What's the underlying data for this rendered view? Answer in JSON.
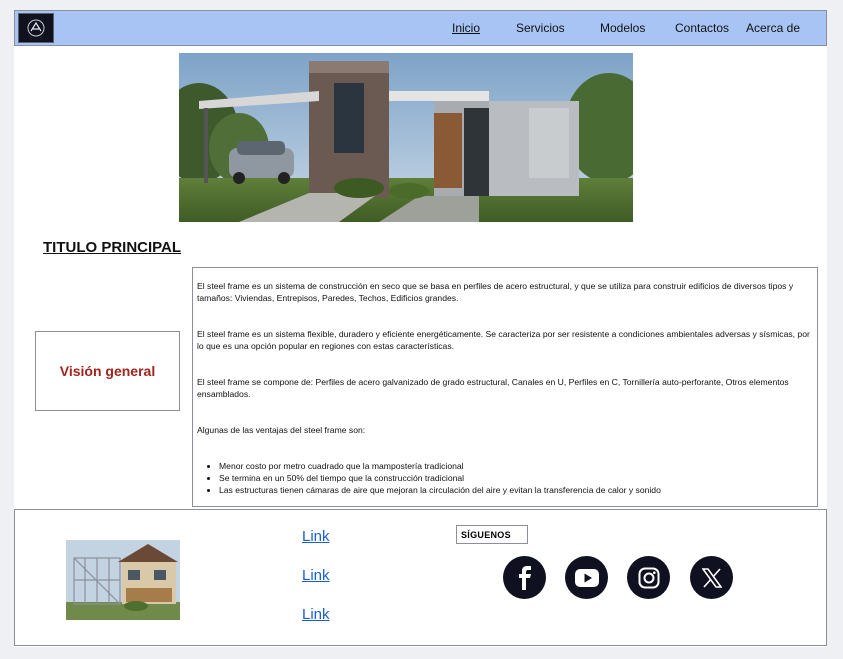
{
  "nav": {
    "logo_icon": "logo-badge-icon",
    "links": [
      "Inicio",
      "Servicios",
      "Modelos",
      "Contactos",
      "Acerca de"
    ]
  },
  "main": {
    "title": "TITULO PRINCIPAL",
    "vision_label": "Visión general",
    "paragraphs": [
      "El steel frame es un sistema de construcción en seco que se basa en perfiles de acero estructural, y que se utiliza para construir edificios de diversos tipos y tamaños: Viviendas, Entrepisos, Paredes, Techos, Edificios grandes.",
      "El steel frame es un sistema flexible, duradero y eficiente energéticamente. Se caracteriza por ser resistente a condiciones ambientales adversas y sísmicas, por lo que es una opción popular en regiones con estas características.",
      "El steel frame se compone de: Perfiles de acero galvanizado de grado estructural, Canales en U, Perfiles en C, Tornillería auto-perforante, Otros elementos ensamblados.",
      "Algunas de las ventajas del steel frame son:"
    ],
    "advantages": [
      "Menor costo por metro cuadrado que la mampostería tradicional",
      "Se termina en un 50% del tiempo que la construcción tradicional",
      "Las estructuras tienen cámaras de aire que mejoran la circulación del aire y evitan la transferencia de calor y sonido"
    ]
  },
  "footer": {
    "links": [
      "Link",
      "Link",
      "Link"
    ],
    "follow_label": "SÍGUENOS",
    "social_icons": [
      "facebook-icon",
      "youtube-icon",
      "instagram-icon",
      "x-icon"
    ]
  },
  "colors": {
    "nav_bg": "#a7c4f5",
    "accent_red": "#a1251d",
    "link_blue": "#1a5fd0",
    "social_bg": "#0f1020"
  }
}
